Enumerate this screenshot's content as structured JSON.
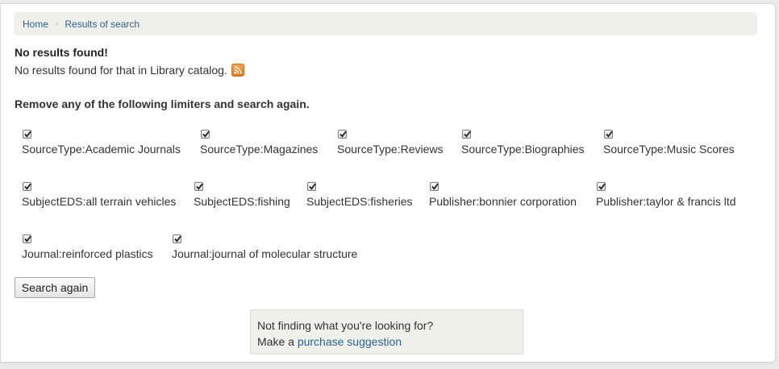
{
  "breadcrumb": {
    "home": "Home",
    "separator": "›",
    "current": "Results of search"
  },
  "heading": "No results found!",
  "message": "No results found for that in Library catalog.",
  "rss_icon": "rss-feed-icon",
  "limiters_heading": "Remove any of the following limiters and search again.",
  "limiters": [
    {
      "label": "SourceType:Academic Journals",
      "checked": true
    },
    {
      "label": "SourceType:Magazines",
      "checked": true
    },
    {
      "label": "SourceType:Reviews",
      "checked": true
    },
    {
      "label": "SourceType:Biographies",
      "checked": true
    },
    {
      "label": "SourceType:Music Scores",
      "checked": true
    },
    {
      "label": "SubjectEDS:all terrain vehicles",
      "checked": true
    },
    {
      "label": "SubjectEDS:fishing",
      "checked": true
    },
    {
      "label": "SubjectEDS:fisheries",
      "checked": true
    },
    {
      "label": "Publisher:bonnier corporation",
      "checked": true
    },
    {
      "label": "Publisher:taylor & francis ltd",
      "checked": true
    },
    {
      "label": "Journal:reinforced plastics",
      "checked": true
    },
    {
      "label": "Journal:journal of molecular structure",
      "checked": true
    }
  ],
  "search_again_label": "Search again",
  "suggestion": {
    "line1": "Not finding what you're looking for?",
    "prefix": "Make a",
    "link": "purchase suggestion"
  },
  "colors": {
    "link": "#2a6496",
    "panel_bg": "#f0f0ea",
    "rss": "#e8761a"
  }
}
